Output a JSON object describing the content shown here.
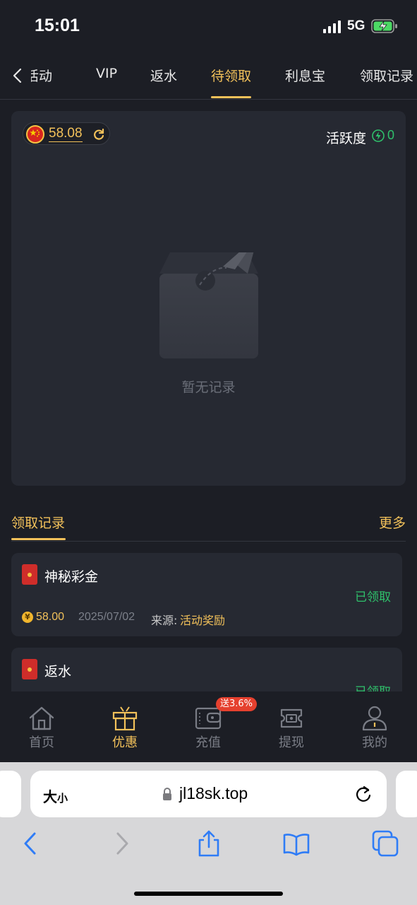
{
  "status_bar": {
    "time": "15:01",
    "network": "5G"
  },
  "tabs": [
    {
      "label": "活动",
      "active": false
    },
    {
      "label": "VIP",
      "active": false
    },
    {
      "label": "返水",
      "active": false
    },
    {
      "label": "待领取",
      "active": true
    },
    {
      "label": "利息宝",
      "active": false
    },
    {
      "label": "领取记录",
      "active": false
    }
  ],
  "panel": {
    "balance": "58.08",
    "activity_label": "活跃度",
    "activity_value": "0",
    "empty_text": "暂无记录"
  },
  "records": {
    "title": "领取记录",
    "more": "更多",
    "items": [
      {
        "title": "神秘彩金",
        "status": "已领取",
        "amount": "58.00",
        "date": "2025/07/02",
        "source_label": "来源:",
        "source_value": "活动奖励"
      },
      {
        "title": "返水",
        "status": "已领取"
      }
    ]
  },
  "bottom_nav": [
    {
      "label": "首页",
      "icon": "home-icon",
      "active": false
    },
    {
      "label": "优惠",
      "icon": "gift-icon",
      "active": true
    },
    {
      "label": "充值",
      "icon": "wallet-icon",
      "active": false
    },
    {
      "label": "提现",
      "icon": "withdraw-icon",
      "active": false
    },
    {
      "label": "我的",
      "icon": "profile-icon",
      "active": false
    }
  ],
  "promo_badge": "送3.6%",
  "browser": {
    "aa_large": "大",
    "aa_small": "小",
    "url": "jl18sk.top"
  },
  "colors": {
    "accent": "#f2c15a",
    "success": "#2fc16b",
    "background": "#1c1e25",
    "card": "#262932"
  }
}
